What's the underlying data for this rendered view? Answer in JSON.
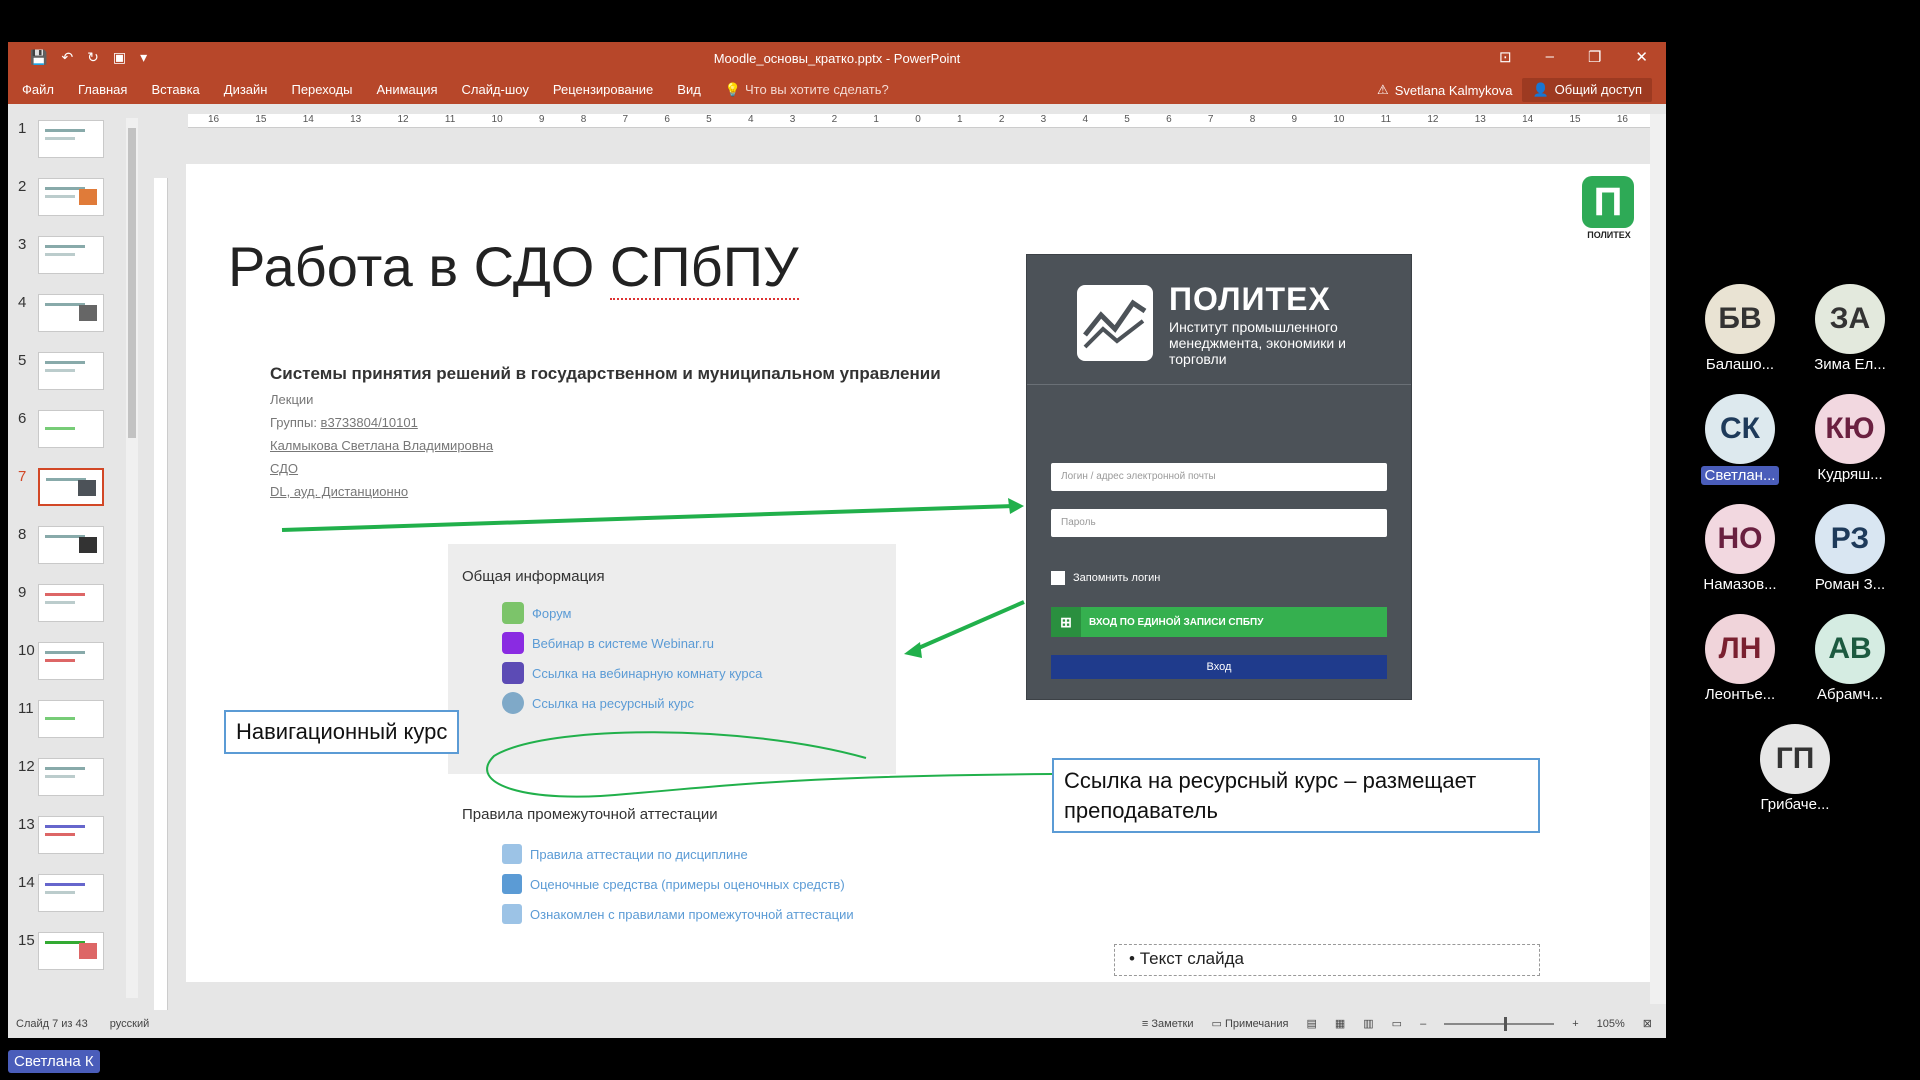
{
  "window": {
    "title": "Moodle_основы_кратко.pptx - PowerPoint",
    "menu": [
      "Файл",
      "Главная",
      "Вставка",
      "Дизайн",
      "Переходы",
      "Анимация",
      "Слайд-шоу",
      "Рецензирование",
      "Вид"
    ],
    "tell_me": "Что вы хотите сделать?",
    "user": "Svetlana Kalmykova",
    "share": "Общий доступ"
  },
  "thumbnails": [
    "1",
    "2",
    "3",
    "4",
    "5",
    "6",
    "7",
    "8",
    "9",
    "10",
    "11",
    "12",
    "13",
    "14",
    "15"
  ],
  "ruler_numbers": [
    "16",
    "15",
    "14",
    "13",
    "12",
    "11",
    "10",
    "9",
    "8",
    "7",
    "6",
    "5",
    "4",
    "3",
    "2",
    "1",
    "0",
    "1",
    "2",
    "3",
    "4",
    "5",
    "6",
    "7",
    "8",
    "9",
    "10",
    "11",
    "12",
    "13",
    "14",
    "15",
    "16"
  ],
  "slide": {
    "title_part1": "Работа в СДО ",
    "title_part2": "СПбПУ",
    "logo_mark": "П",
    "logo_text": "ПОЛИТЕХ",
    "course_name": "Системы принятия решений в государственном и муниципальном управлении",
    "lectures": "Лекции",
    "groups_label": "Группы: ",
    "groups_value": "в3733804/10101",
    "teacher": "Калмыкова Светлана Владимировна",
    "sdo": "СДО",
    "dl": "DL, ауд. Дистанционно",
    "general_header": "Общая информация",
    "resources": [
      "Форум",
      "Вебинар в системе Webinar.ru",
      "Ссылка на вебинарную комнату курса",
      "Ссылка на ресурсный курс"
    ],
    "rules_header": "Правила промежуточной аттестации",
    "rules": [
      "Правила аттестации по дисциплине",
      "Оценочные средства (примеры оценочных средств)",
      "Ознакомлен с правилами промежуточной аттестации"
    ],
    "nav_label": "Навигационный курс",
    "callout": "Ссылка на ресурсный курс – размещает преподаватель",
    "text_placeholder": "Текст слайда",
    "login": {
      "name": "ПОЛИТЕХ",
      "subtitle": "Институт промышленного менеджмента, экономики и торговли",
      "login_placeholder": "Логин / адрес электронной почты",
      "password_placeholder": "Пароль",
      "remember": "Запомнить логин",
      "sso": "ВХОД ПО ЕДИНОЙ ЗАПИСИ СПБПУ",
      "enter": "Вход"
    }
  },
  "status": {
    "slide_info": "Слайд 7 из 43",
    "language": "русский",
    "notes": "Заметки",
    "comments": "Примечания",
    "zoom": "105%"
  },
  "participants": [
    {
      "initials": "БВ",
      "name": "Балашо...",
      "bg": "#e9e3d3",
      "fg": "#333333"
    },
    {
      "initials": "ЗА",
      "name": "Зима Ел...",
      "bg": "#e3e9dd",
      "fg": "#333333"
    },
    {
      "initials": "СК",
      "name": "Светлан...",
      "bg": "#dde9ee",
      "fg": "#1e3a5a"
    },
    {
      "initials": "КЮ",
      "name": "Кудряш...",
      "bg": "#f2d8e0",
      "fg": "#6a2040"
    },
    {
      "initials": "НО",
      "name": "Намазов...",
      "bg": "#f2d8e0",
      "fg": "#6a2040"
    },
    {
      "initials": "РЗ",
      "name": "Роман З...",
      "bg": "#d9e6f2",
      "fg": "#1e3a5a"
    },
    {
      "initials": "ЛН",
      "name": "Леонтье...",
      "bg": "#f0d4da",
      "fg": "#7a2030"
    },
    {
      "initials": "АВ",
      "name": "Абрамч...",
      "bg": "#d5ece2",
      "fg": "#1c5a40"
    },
    {
      "initials": "ГП",
      "name": "Грибаче...",
      "bg": "#e7e7e7",
      "fg": "#333333"
    }
  ],
  "presenter": "Светлана К"
}
